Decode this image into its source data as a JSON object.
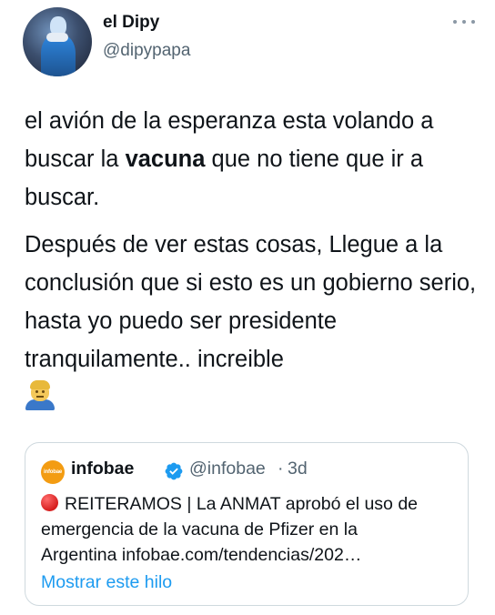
{
  "author": {
    "display_name": "el Dipy",
    "handle": "@dipypapa"
  },
  "tweet": {
    "paragraph1_before": "el avión de la esperanza esta volando a buscar la ",
    "paragraph1_bold": "vacuna",
    "paragraph1_after": " que no tiene que ir a buscar.",
    "paragraph2": "Después de ver estas cosas, Llegue a la conclusión que si esto es un gobierno serio, hasta yo puedo ser presidente tranquilamente.. increible"
  },
  "quoted_tweet": {
    "logo_text": "infobae",
    "display_name": "infobae",
    "handle": "@infobae",
    "separator": "·",
    "time": "3d",
    "line1": "REITERAMOS | La ANMAT aprobó el uso de",
    "line2": "emergencia de la vacuna de Pfizer en la",
    "line3": "Argentina infobae.com/tendencias/202…",
    "show_thread": "Mostrar este hilo"
  },
  "colors": {
    "accent": "#1d9bf0",
    "secondary_text": "#536471",
    "border": "#cfd9de"
  },
  "icons": {
    "more": "more-horizontal-icon",
    "verified": "verified-badge-icon",
    "emoji": "man-facepalming-emoji",
    "red_circle": "red-circle-emoji"
  }
}
